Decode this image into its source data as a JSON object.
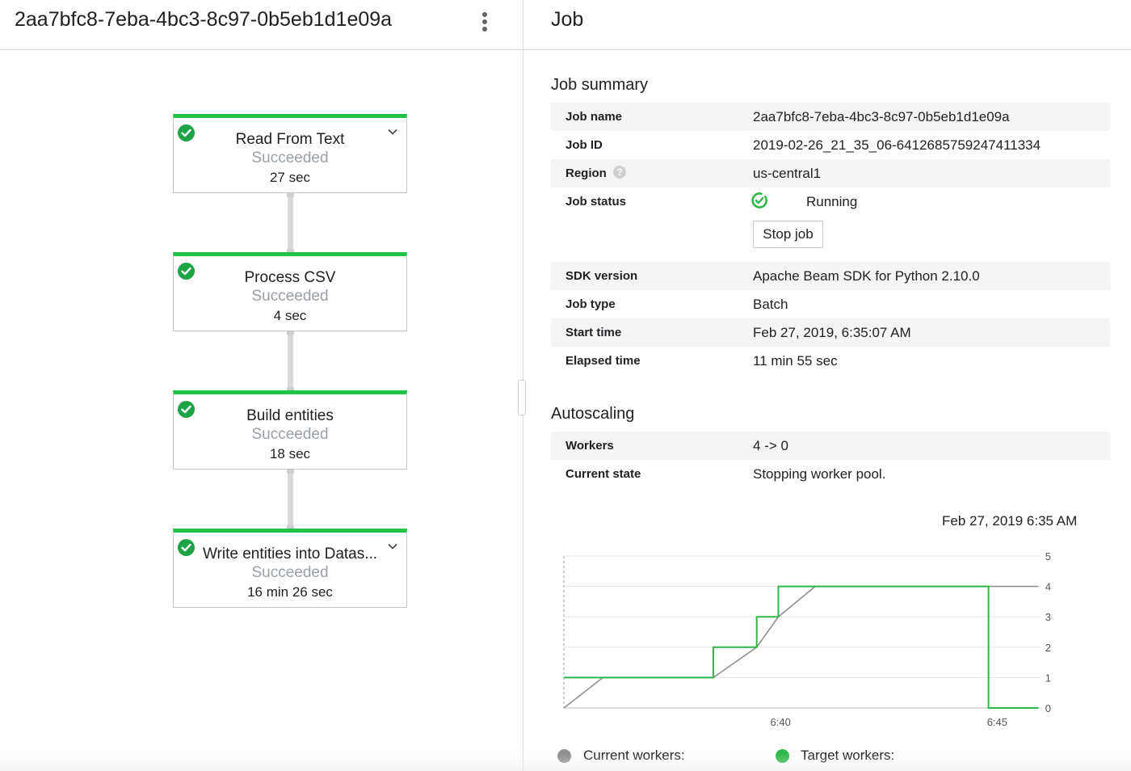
{
  "left": {
    "job_title": "2aa7bfc8-7eba-4bc3-8c97-0b5eb1d1e09a",
    "menu_icon": "more-vertical-icon",
    "steps": [
      {
        "name": "Read From Text",
        "status": "Succeeded",
        "time": "27 sec",
        "expandable": true
      },
      {
        "name": "Process CSV",
        "status": "Succeeded",
        "time": "4 sec",
        "expandable": false
      },
      {
        "name": "Build entities",
        "status": "Succeeded",
        "time": "18 sec",
        "expandable": false
      },
      {
        "name": "Write entities into Datas...",
        "status": "Succeeded",
        "time": "16 min 26 sec",
        "expandable": true
      }
    ]
  },
  "right": {
    "title": "Job",
    "summary": {
      "heading": "Job summary",
      "job_name_label": "Job name",
      "job_name": "2aa7bfc8-7eba-4bc3-8c97-0b5eb1d1e09a",
      "job_id_label": "Job ID",
      "job_id": "2019-02-26_21_35_06-6412685759247411334",
      "region_label": "Region",
      "region_help": "?",
      "region": "us-central1",
      "status_label": "Job status",
      "status": "Running",
      "stop_button": "Stop job",
      "sdk_label": "SDK version",
      "sdk": "Apache Beam SDK for Python 2.10.0",
      "type_label": "Job type",
      "type": "Batch",
      "start_label": "Start time",
      "start": "Feb 27, 2019, 6:35:07 AM",
      "elapsed_label": "Elapsed time",
      "elapsed": "11 min 55 sec"
    },
    "autoscaling": {
      "heading": "Autoscaling",
      "workers_label": "Workers",
      "workers": "4 -> 0",
      "state_label": "Current state",
      "state": "Stopping worker pool."
    },
    "legend": {
      "current": "Current workers:",
      "target": "Target workers:"
    }
  },
  "colors": {
    "success_green": "#1ea446",
    "step_bar_green": "#22c148",
    "target_line": "#2fb84a",
    "current_line": "#8f8f8f"
  },
  "chart_data": {
    "type": "line",
    "timestamp": "Feb 27, 2019 6:35 AM",
    "x_ticks": [
      "6:40",
      "6:45"
    ],
    "x_tick_minutes": [
      40,
      45
    ],
    "x_range_minutes": [
      35.0,
      46.0
    ],
    "y_ticks": [
      0,
      1,
      2,
      3,
      4,
      5
    ],
    "ylim": [
      0,
      5
    ],
    "grid": true,
    "series": [
      {
        "name": "Current workers:",
        "color": "#8f8f8f",
        "x": [
          35.0,
          35.9,
          38.45,
          39.45,
          39.95,
          40.8,
          45.95
        ],
        "y": [
          0,
          1,
          1,
          2,
          3,
          4,
          4
        ]
      },
      {
        "name": "Target workers:",
        "color": "#2fb84a",
        "x": [
          35.0,
          38.45,
          38.45,
          39.45,
          39.45,
          39.95,
          39.95,
          40.8,
          44.8,
          44.8,
          45.95
        ],
        "y": [
          1,
          1,
          2,
          2,
          3,
          3,
          4,
          4,
          4,
          0,
          0
        ]
      }
    ]
  }
}
